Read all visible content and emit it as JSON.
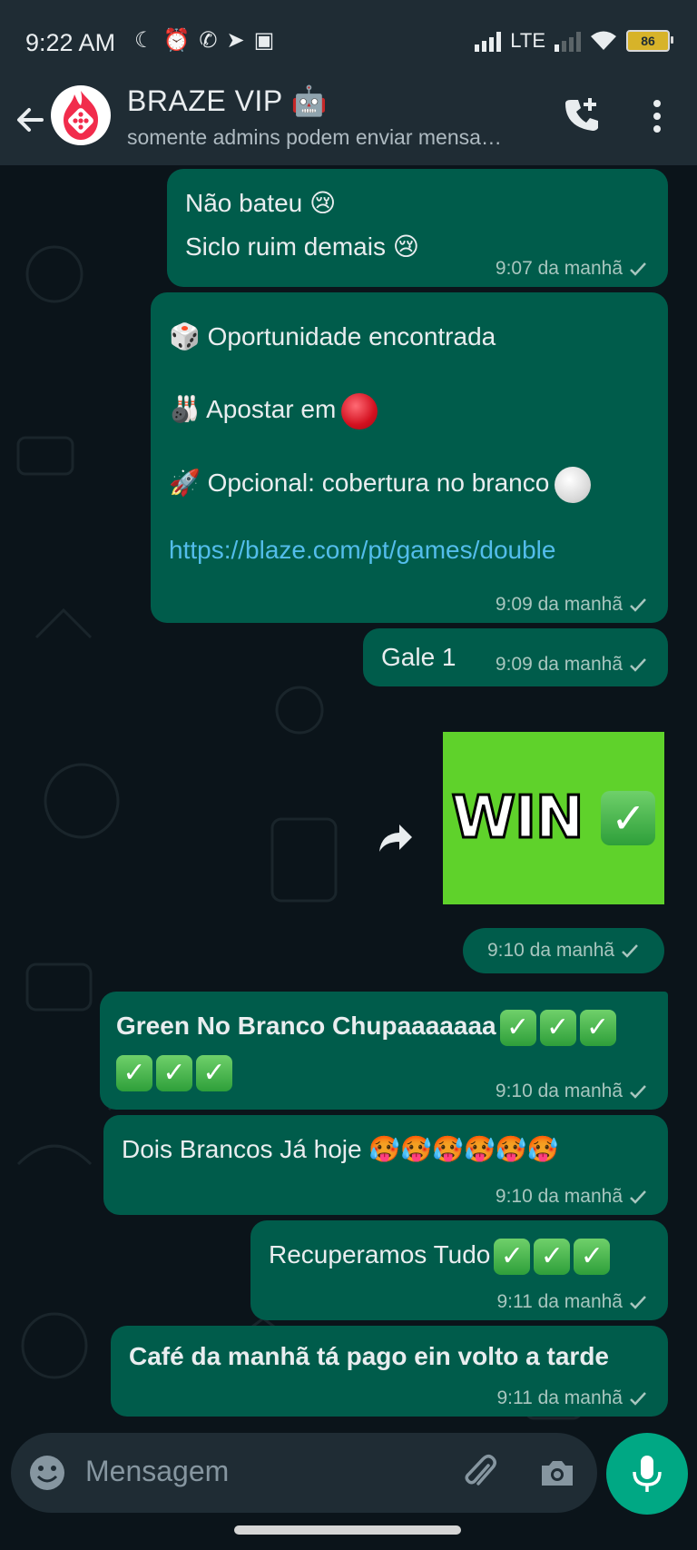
{
  "status_bar": {
    "time": "9:22 AM",
    "network": "LTE",
    "battery": "86"
  },
  "header": {
    "title": "BRAZE VIP 🤖",
    "subtitle": "somente admins podem enviar mensa…"
  },
  "messages": [
    {
      "lines": [
        "Não bateu 😢",
        "Siclo ruim demais 😢"
      ],
      "time": "9:07 da manhã"
    },
    {
      "lines": [
        "🎲 Oportunidade encontrada",
        "🎳 Apostar em",
        "🚀 Opcional: cobertura no branco"
      ],
      "link": "https://blaze.com/pt/games/double",
      "time": "9:09 da manhã"
    },
    {
      "lines": [
        "Gale 1"
      ],
      "time": "9:09 da manhã"
    },
    {
      "sticker_text": "WIN",
      "time": "9:10 da manhã"
    },
    {
      "lines": [
        "Green No Branco Chupaaaaaaa"
      ],
      "time": "9:10 da manhã"
    },
    {
      "lines": [
        "Dois Brancos Já hoje 🥵🥵🥵🥵🥵🥵"
      ],
      "time": "9:10 da manhã"
    },
    {
      "lines": [
        "Recuperamos Tudo"
      ],
      "time": "9:11 da manhã"
    },
    {
      "lines": [
        "Café da manhã tá pago ein volto a tarde"
      ],
      "time": "9:11 da manhã"
    }
  ],
  "composer": {
    "placeholder": "Mensagem"
  },
  "colors": {
    "background": "#0b141a",
    "bar": "#1f2c34",
    "bubble_out": "#005c4b",
    "accent": "#00a884",
    "link": "#53bdeb"
  },
  "icons": [
    "back-arrow-icon",
    "add-call-icon",
    "more-vert-icon",
    "forward-icon",
    "emoji-icon",
    "attach-icon",
    "camera-icon",
    "mic-icon",
    "double-check-icon"
  ]
}
